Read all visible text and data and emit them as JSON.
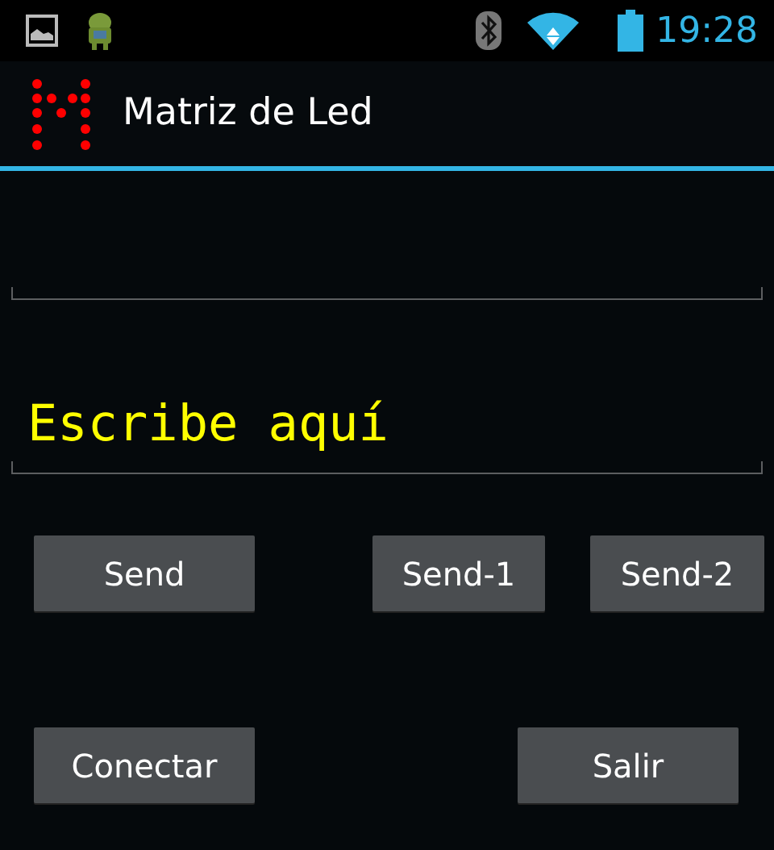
{
  "status_bar": {
    "time": "19:28"
  },
  "action_bar": {
    "title": "Matriz de Led"
  },
  "fields": [
    {
      "focused": false
    },
    {
      "placeholder": "Escribe aquí",
      "focused": false
    }
  ],
  "button_rows": [
    {
      "buttons": [
        "Send",
        "Send-1",
        "Send-2"
      ]
    },
    {
      "buttons": [
        "Conectar",
        "Salir"
      ]
    }
  ]
}
